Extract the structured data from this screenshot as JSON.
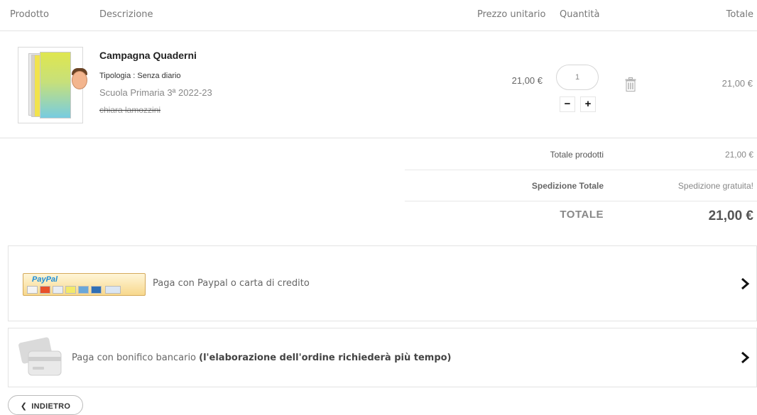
{
  "header": {
    "product": "Prodotto",
    "description": "Descrizione",
    "unit_price": "Prezzo unitario",
    "quantity": "Quantità",
    "total": "Totale"
  },
  "item": {
    "title": "Campagna Quaderni",
    "type": "Tipologia : Senza diario",
    "school": "Scuola Primaria 3ª 2022-23",
    "owner": "chiara lamozzini",
    "unit_price": "21,00 €",
    "quantity": "1",
    "minus": "−",
    "plus": "+",
    "line_total": "21,00 €"
  },
  "summary": {
    "products_label": "Totale prodotti",
    "products_value": "21,00 €",
    "shipping_label": "Spedizione Totale",
    "shipping_value": "Spedizione gratuita!",
    "total_label": "TOTALE",
    "total_value": "21,00 €"
  },
  "payment": {
    "paypal_logo_a": "Pay",
    "paypal_logo_b": "Pal",
    "paypal_text": "Paga con Paypal o carta di credito",
    "bank_text": "Paga con bonifico bancario",
    "bank_note": "(l'elaborazione dell'ordine richiederà più tempo)"
  },
  "back": {
    "label": "INDIETRO"
  },
  "icons": {
    "trash": "trash-icon",
    "chevron": "chevron-right-icon",
    "back": "chevron-left-icon",
    "bank": "bank-card-icon"
  },
  "colors": {
    "border": "#e3e3e3",
    "paypal_blue": "#0e3d8f",
    "paypal_gold": "#f7d88c"
  }
}
